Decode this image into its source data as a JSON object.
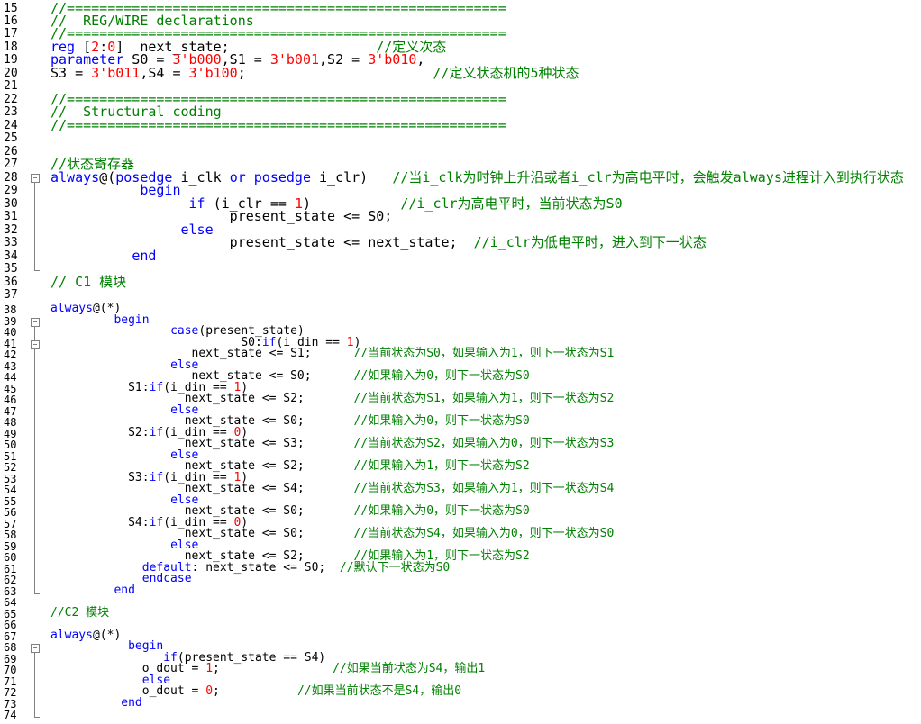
{
  "editor": {
    "lines": [
      {
        "n": "15",
        "parts": [
          [
            "c-com",
            "//======================================================"
          ]
        ]
      },
      {
        "n": "16",
        "parts": [
          [
            "c-com",
            "//  REG/WIRE declarations"
          ]
        ]
      },
      {
        "n": "17",
        "parts": [
          [
            "c-com",
            "//======================================================"
          ]
        ]
      },
      {
        "n": "18",
        "parts": [
          [
            "c-kw",
            "reg"
          ],
          [
            "c-txt",
            " ["
          ],
          [
            "c-num",
            "2"
          ],
          [
            "c-txt",
            ":"
          ],
          [
            "c-num",
            "0"
          ],
          [
            "c-txt",
            "]  next_state;                  "
          ],
          [
            "c-com",
            "//定义次态"
          ]
        ]
      },
      {
        "n": "19",
        "parts": [
          [
            "c-kw",
            "parameter"
          ],
          [
            "c-txt",
            " S0 = "
          ],
          [
            "c-num",
            "3'b000"
          ],
          [
            "c-txt",
            ",S1 = "
          ],
          [
            "c-num",
            "3'b001"
          ],
          [
            "c-txt",
            ",S2 = "
          ],
          [
            "c-num",
            "3'b010"
          ],
          [
            "c-txt",
            ","
          ]
        ]
      },
      {
        "n": "20",
        "parts": [
          [
            "c-txt",
            "S3 = "
          ],
          [
            "c-num",
            "3'b011"
          ],
          [
            "c-txt",
            ",S4 = "
          ],
          [
            "c-num",
            "3'b100"
          ],
          [
            "c-txt",
            ";                       "
          ],
          [
            "c-com",
            "//定义状态机的5种状态"
          ]
        ]
      },
      {
        "n": "21",
        "parts": []
      },
      {
        "n": "22",
        "parts": [
          [
            "c-com",
            "//======================================================"
          ]
        ]
      },
      {
        "n": "23",
        "parts": [
          [
            "c-com",
            "//  Structural coding"
          ]
        ]
      },
      {
        "n": "24",
        "parts": [
          [
            "c-com",
            "//======================================================"
          ]
        ]
      },
      {
        "n": "25",
        "parts": []
      },
      {
        "n": "26",
        "parts": []
      },
      {
        "n": "27",
        "parts": [
          [
            "c-com",
            "//状态寄存器"
          ]
        ]
      },
      {
        "n": "28",
        "parts": [
          [
            "c-kw",
            "always"
          ],
          [
            "c-txt",
            "@("
          ],
          [
            "c-kw",
            "posedge"
          ],
          [
            "c-txt",
            " i_clk "
          ],
          [
            "c-kw",
            "or"
          ],
          [
            "c-txt",
            " "
          ],
          [
            "c-kw",
            "posedge"
          ],
          [
            "c-txt",
            " i_clr)   "
          ],
          [
            "c-com",
            "//当i_clk为时钟上升沿或者i_clr为高电平时，会触发always进程计入到执行状态"
          ]
        ]
      },
      {
        "n": "29",
        "parts": [
          [
            "c-txt",
            "           "
          ],
          [
            "c-kw",
            "begin"
          ]
        ]
      },
      {
        "n": "30",
        "parts": [
          [
            "c-txt",
            "                 "
          ],
          [
            "c-kw",
            "if"
          ],
          [
            "c-txt",
            " (i_clr == "
          ],
          [
            "c-num",
            "1"
          ],
          [
            "c-txt",
            ")           "
          ],
          [
            "c-com",
            "//i_clr为高电平时，当前状态为S0"
          ]
        ]
      },
      {
        "n": "31",
        "parts": [
          [
            "c-txt",
            "                      present_state <= S0;"
          ]
        ]
      },
      {
        "n": "32",
        "parts": [
          [
            "c-txt",
            "                "
          ],
          [
            "c-kw",
            "else"
          ]
        ]
      },
      {
        "n": "33",
        "parts": [
          [
            "c-txt",
            "                      present_state <= next_state;  "
          ],
          [
            "c-com",
            "//i_clr为低电平时，进入到下一状态"
          ]
        ]
      },
      {
        "n": "34",
        "parts": [
          [
            "c-txt",
            "          "
          ],
          [
            "c-kw",
            "end"
          ]
        ]
      },
      {
        "n": "35",
        "parts": []
      },
      {
        "n": "36",
        "parts": [
          [
            "c-com",
            "// C1 模块"
          ]
        ]
      },
      {
        "n": "37",
        "parts": []
      },
      {
        "n": "38",
        "parts": [
          [
            "c-kw",
            "always"
          ],
          [
            "c-txt",
            "@(*)"
          ]
        ]
      },
      {
        "n": "39",
        "parts": [
          [
            "c-txt",
            "         "
          ],
          [
            "c-kw",
            "begin"
          ]
        ]
      },
      {
        "n": "40",
        "parts": [
          [
            "c-txt",
            "                 "
          ],
          [
            "c-kw",
            "case"
          ],
          [
            "c-txt",
            "(present_state)"
          ]
        ]
      },
      {
        "n": "41",
        "parts": [
          [
            "c-txt",
            "                           S0:"
          ],
          [
            "c-kw",
            "if"
          ],
          [
            "c-txt",
            "(i_din == "
          ],
          [
            "c-num",
            "1"
          ],
          [
            "c-txt",
            ")"
          ]
        ]
      },
      {
        "n": "42",
        "parts": [
          [
            "c-txt",
            "                    next_state <= S1;      "
          ],
          [
            "c-com",
            "//当前状态为S0，如果输入为1，则下一状态为S1"
          ]
        ]
      },
      {
        "n": "43",
        "parts": [
          [
            "c-txt",
            "                 "
          ],
          [
            "c-kw",
            "else"
          ]
        ]
      },
      {
        "n": "44",
        "parts": [
          [
            "c-txt",
            "                    next_state <= S0;      "
          ],
          [
            "c-com",
            "//如果输入为0，则下一状态为S0"
          ]
        ]
      },
      {
        "n": "45",
        "parts": [
          [
            "c-txt",
            "           S1:"
          ],
          [
            "c-kw",
            "if"
          ],
          [
            "c-txt",
            "(i_din == "
          ],
          [
            "c-num",
            "1"
          ],
          [
            "c-txt",
            ")"
          ]
        ]
      },
      {
        "n": "46",
        "parts": [
          [
            "c-txt",
            "                   next_state <= S2;       "
          ],
          [
            "c-com",
            "//当前状态为S1，如果输入为1，则下一状态为S2"
          ]
        ]
      },
      {
        "n": "47",
        "parts": [
          [
            "c-txt",
            "                 "
          ],
          [
            "c-kw",
            "else"
          ]
        ]
      },
      {
        "n": "48",
        "parts": [
          [
            "c-txt",
            "                   next_state <= S0;       "
          ],
          [
            "c-com",
            "//如果输入为0，则下一状态为S0"
          ]
        ]
      },
      {
        "n": "49",
        "parts": [
          [
            "c-txt",
            "           S2:"
          ],
          [
            "c-kw",
            "if"
          ],
          [
            "c-txt",
            "(i_din == "
          ],
          [
            "c-num",
            "0"
          ],
          [
            "c-txt",
            ")"
          ]
        ]
      },
      {
        "n": "50",
        "parts": [
          [
            "c-txt",
            "                   next_state <= S3;       "
          ],
          [
            "c-com",
            "//当前状态为S2，如果输入为0，则下一状态为S3"
          ]
        ]
      },
      {
        "n": "51",
        "parts": [
          [
            "c-txt",
            "                 "
          ],
          [
            "c-kw",
            "else"
          ]
        ]
      },
      {
        "n": "52",
        "parts": [
          [
            "c-txt",
            "                   next_state <= S2;       "
          ],
          [
            "c-com",
            "//如果输入为1，则下一状态为S2"
          ]
        ]
      },
      {
        "n": "53",
        "parts": [
          [
            "c-txt",
            "           S3:"
          ],
          [
            "c-kw",
            "if"
          ],
          [
            "c-txt",
            "(i_din == "
          ],
          [
            "c-num",
            "1"
          ],
          [
            "c-txt",
            ")"
          ]
        ]
      },
      {
        "n": "54",
        "parts": [
          [
            "c-txt",
            "                   next_state <= S4;       "
          ],
          [
            "c-com",
            "//当前状态为S3，如果输入为1，则下一状态为S4"
          ]
        ]
      },
      {
        "n": "55",
        "parts": [
          [
            "c-txt",
            "                 "
          ],
          [
            "c-kw",
            "else"
          ]
        ]
      },
      {
        "n": "56",
        "parts": [
          [
            "c-txt",
            "                   next_state <= S0;       "
          ],
          [
            "c-com",
            "//如果输入为0，则下一状态为S0"
          ]
        ]
      },
      {
        "n": "57",
        "parts": [
          [
            "c-txt",
            "           S4:"
          ],
          [
            "c-kw",
            "if"
          ],
          [
            "c-txt",
            "(i_din == "
          ],
          [
            "c-num",
            "0"
          ],
          [
            "c-txt",
            ")"
          ]
        ]
      },
      {
        "n": "58",
        "parts": [
          [
            "c-txt",
            "                   next_state <= S0;       "
          ],
          [
            "c-com",
            "//当前状态为S4，如果输入为0，则下一状态为S0"
          ]
        ]
      },
      {
        "n": "59",
        "parts": [
          [
            "c-txt",
            "                 "
          ],
          [
            "c-kw",
            "else"
          ]
        ]
      },
      {
        "n": "60",
        "parts": [
          [
            "c-txt",
            "                   next_state <= S2;       "
          ],
          [
            "c-com",
            "//如果输入为1，则下一状态为S2"
          ]
        ]
      },
      {
        "n": "61",
        "parts": [
          [
            "c-txt",
            "             "
          ],
          [
            "c-kw",
            "default"
          ],
          [
            "c-txt",
            ": next_state <= S0;  "
          ],
          [
            "c-com",
            "//默认下一状态为S0"
          ]
        ]
      },
      {
        "n": "62",
        "parts": [
          [
            "c-txt",
            "             "
          ],
          [
            "c-kw",
            "endcase"
          ]
        ]
      },
      {
        "n": "63",
        "parts": [
          [
            "c-txt",
            "         "
          ],
          [
            "c-kw",
            "end"
          ]
        ]
      },
      {
        "n": "64",
        "parts": []
      },
      {
        "n": "65",
        "parts": [
          [
            "c-com",
            "//C2 模块"
          ]
        ]
      },
      {
        "n": "66",
        "parts": []
      },
      {
        "n": "67",
        "parts": [
          [
            "c-kw",
            "always"
          ],
          [
            "c-txt",
            "@(*)"
          ]
        ]
      },
      {
        "n": "68",
        "parts": [
          [
            "c-txt",
            "           "
          ],
          [
            "c-kw",
            "begin"
          ]
        ]
      },
      {
        "n": "69",
        "parts": [
          [
            "c-txt",
            "                "
          ],
          [
            "c-kw",
            "if"
          ],
          [
            "c-txt",
            "(present_state == S4)"
          ]
        ]
      },
      {
        "n": "70",
        "parts": [
          [
            "c-txt",
            "             o_dout = "
          ],
          [
            "c-num",
            "1"
          ],
          [
            "c-txt",
            ";                "
          ],
          [
            "c-com",
            "//如果当前状态为S4，输出1"
          ]
        ]
      },
      {
        "n": "71",
        "parts": [
          [
            "c-txt",
            "             "
          ],
          [
            "c-kw",
            "else"
          ]
        ]
      },
      {
        "n": "72",
        "parts": [
          [
            "c-txt",
            "             o_dout = "
          ],
          [
            "c-num",
            "0"
          ],
          [
            "c-txt",
            ";           "
          ],
          [
            "c-com",
            "//如果当前状态不是S4，输出0"
          ]
        ]
      },
      {
        "n": "73",
        "parts": [
          [
            "c-txt",
            "          "
          ],
          [
            "c-kw",
            "end"
          ]
        ]
      },
      {
        "n": "74",
        "parts": []
      }
    ]
  }
}
